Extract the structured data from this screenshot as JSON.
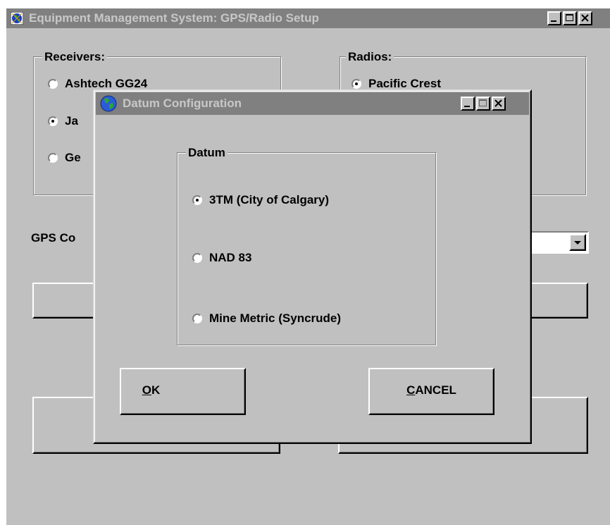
{
  "main_window": {
    "title": "Equipment Management System: GPS/Radio Setup",
    "icon": "app-globe-icon",
    "receivers": {
      "legend": "Receivers:",
      "options": [
        {
          "label": "Ashtech GG24",
          "selected": false
        },
        {
          "label": "Ja",
          "selected": true
        },
        {
          "label": "Ge",
          "selected": false
        }
      ]
    },
    "radios": {
      "legend": "Radios:",
      "options": [
        {
          "label": "Pacific Crest",
          "selected": true
        }
      ]
    },
    "gps_label": "GPS Co",
    "dropdown_icon": "chevron-down-icon"
  },
  "dialog": {
    "title": "Datum Configuration",
    "icon": "globe-icon",
    "datum": {
      "legend": "Datum",
      "options": [
        {
          "label": "3TM (City of Calgary)",
          "selected": true
        },
        {
          "label": "NAD 83",
          "selected": false
        },
        {
          "label": "Mine Metric (Syncrude)",
          "selected": false
        }
      ]
    },
    "ok_mnemonic": "O",
    "ok_rest": "K",
    "cancel_mnemonic": "C",
    "cancel_rest": "ANCEL"
  },
  "colors": {
    "face": "#c0c0c0",
    "inactive_titlebar": "#808080",
    "inactive_title_text": "#c8c8c8"
  }
}
